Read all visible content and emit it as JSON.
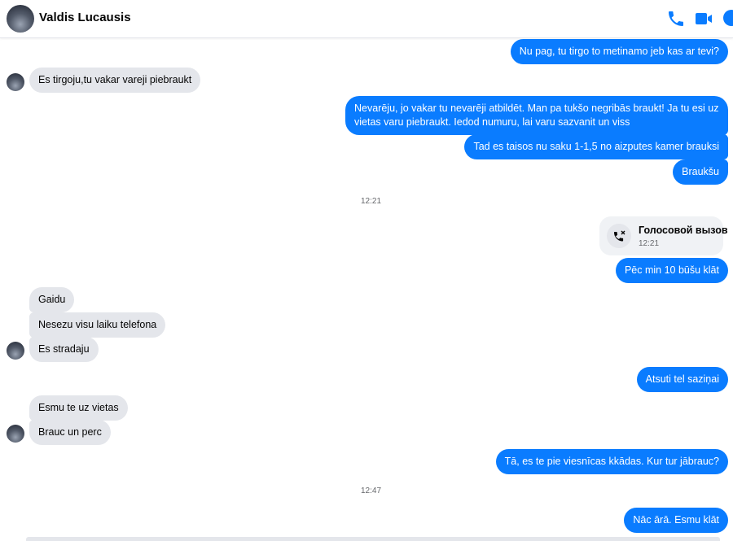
{
  "header": {
    "contact_name": "Valdis Lucausis"
  },
  "messages": {
    "m1": "Nu pag, tu tirgo to metinamo jeb kas ar tevi?",
    "m2": "Es tirgoju,tu vakar vareji piebraukt",
    "m3": "Nevarēju, jo vakar tu nevarēji atbildēt. Man pa tukšo negribās braukt! Ja tu esi uz vietas varu piebraukt. Iedod numuru, lai varu sazvanit un viss",
    "m4": "Tad es taisos nu saku 1-1,5 no aizputes kamer brauksi",
    "m5": "Braukšu",
    "ts1": "12:21",
    "call_title": "Голосовой вызов",
    "call_time": "12:21",
    "m6": "Pēc min 10 būšu klāt",
    "m7": "Gaidu",
    "m8": "Nesezu visu laiku telefona",
    "m9": "Es stradaju",
    "m10": "Atsuti tel saziņai",
    "m11": "Esmu te uz vietas",
    "m12": "Brauc un perc",
    "m13": "Tā, es te pie viesnīcas kkādas. Kur tur jābrauc?",
    "ts2": "12:47",
    "m14": "Nāc ārā. Esmu klāt"
  },
  "colors": {
    "accent": "#0a7cff",
    "incoming_bubble": "#e4e6eb"
  },
  "icons": [
    "phone-icon",
    "video-camera-icon",
    "info-icon",
    "missed-call-icon"
  ]
}
